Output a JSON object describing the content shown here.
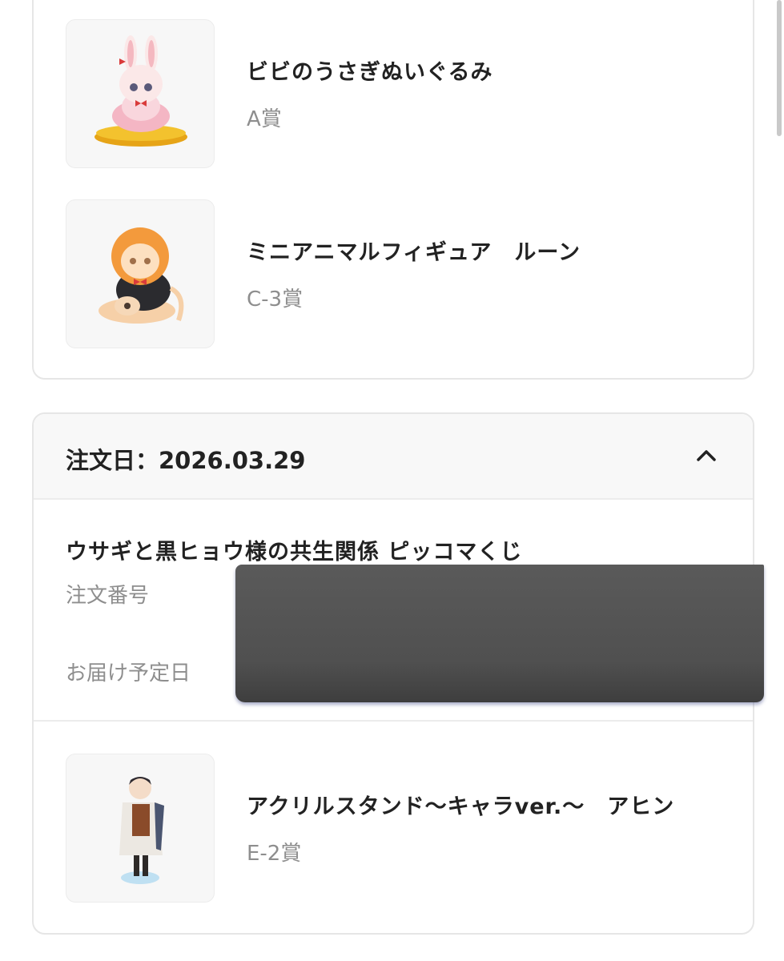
{
  "previous_order": {
    "items": [
      {
        "name": "ビビのうさぎぬいぐるみ",
        "prize": "A賞",
        "icon": "rabbit-plush-thumbnail"
      },
      {
        "name": "ミニアニマルフィギュア　ルーン",
        "prize": "C-3賞",
        "icon": "lion-figure-thumbnail"
      }
    ]
  },
  "order": {
    "date_label": "注文日：2026.03.29",
    "collapse_icon": "chevron-up-icon",
    "lottery_title": "ウサギと黒ヒョウ様の共生関係 ピッコマくじ",
    "order_number_label": "注文番号",
    "delivery_date_label": "お届け予定日",
    "items": [
      {
        "name": "アクリルスタンド〜キャラver.〜　アヒン",
        "prize": "E-2賞",
        "icon": "acrylic-stand-thumbnail"
      }
    ]
  }
}
